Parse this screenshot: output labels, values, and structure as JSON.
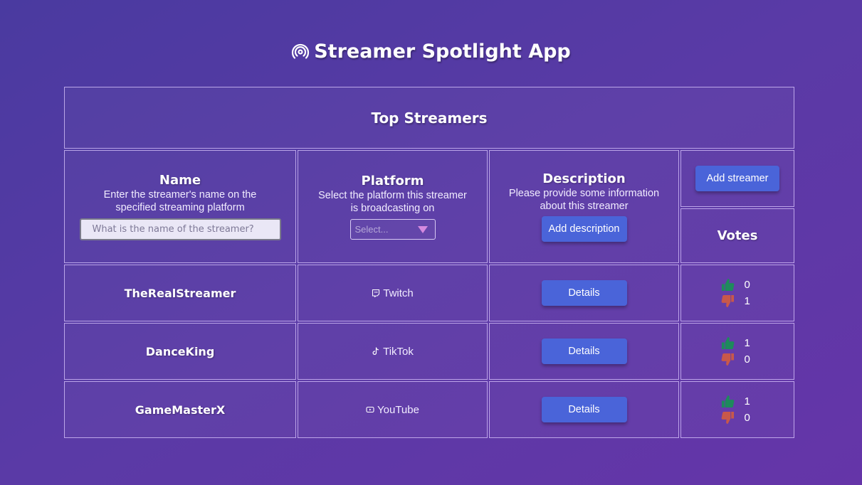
{
  "app": {
    "title": "Streamer Spotlight App",
    "icon": "broadcast-icon"
  },
  "table": {
    "header": "Top Streamers",
    "columns": {
      "name": {
        "title": "Name",
        "hint": "Enter the streamer's name on the specified streaming platform",
        "placeholder": "What is the name of the streamer?"
      },
      "platform": {
        "title": "Platform",
        "hint": "Select the platform this streamer is broadcasting on",
        "select_placeholder": "Select..."
      },
      "description": {
        "title": "Description",
        "hint": "Please provide some information about this streamer",
        "button": "Add description"
      },
      "add_button": "Add streamer",
      "votes": {
        "title": "Votes"
      }
    },
    "rows": [
      {
        "name": "TheRealStreamer",
        "platform": "Twitch",
        "platform_icon": "twitch-icon",
        "details": "Details",
        "upvotes": "0",
        "downvotes": "1"
      },
      {
        "name": "DanceKing",
        "platform": "TikTok",
        "platform_icon": "tiktok-icon",
        "details": "Details",
        "upvotes": "1",
        "downvotes": "0"
      },
      {
        "name": "GameMasterX",
        "platform": "YouTube",
        "platform_icon": "youtube-icon",
        "details": "Details",
        "upvotes": "1",
        "downvotes": "0"
      }
    ]
  },
  "colors": {
    "upvote": "#1e8a5c",
    "downvote": "#c8584a",
    "button": "#4a64d9"
  }
}
